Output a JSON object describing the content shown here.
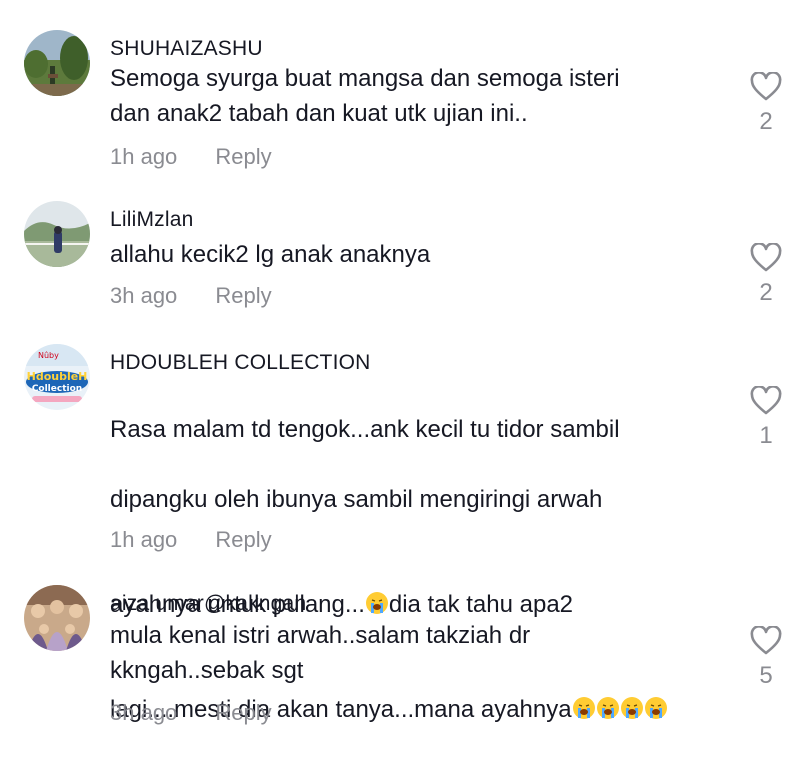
{
  "comments": [
    {
      "username": "SHUHAIZASHU",
      "text": "Semoga syurga buat mangsa dan semoga isteri\ndan anak2 tabah dan kuat utk ujian ini..",
      "time": "1h ago",
      "reply_label": "Reply",
      "likes": "2",
      "avatar_icon": "avatar-landscape-photo"
    },
    {
      "username": "LiliMzlan",
      "text": "allahu kecik2 lg anak anaknya",
      "time": "3h ago",
      "reply_label": "Reply",
      "likes": "2",
      "avatar_icon": "avatar-mountain-photo"
    },
    {
      "username": "HDOUBLEH COLLECTION",
      "text_lines": [
        "Rasa malam td tengok...ank kecil tu tidor sambil",
        "dipangku oleh ibunya sambil mengiringi arwah",
        "ayahnya untuk pulang...",
        "dia tak tahu apa2",
        "lagi....mesti dia akan tanya...mana ayahnya"
      ],
      "time": "1h ago",
      "reply_label": "Reply",
      "likes": "1",
      "avatar_icon": "avatar-logo",
      "avatar_text": {
        "top": "Nûby",
        "main": "HdoubleH",
        "sub": "Collection"
      }
    },
    {
      "username": "aiza umar@kakngah",
      "text": "mula kenal istri arwah..salam takziah dr\nkkngah..sebak sgt",
      "time": "3h ago",
      "reply_label": "Reply",
      "likes": "5",
      "avatar_icon": "avatar-group-photo"
    }
  ],
  "colors": {
    "text": "#161823",
    "secondary": "#8a8b91",
    "heart_outline": "#8a8b91"
  },
  "icons": {
    "like": "heart-outline-icon",
    "emoji": "loudly-crying-face-emoji"
  }
}
